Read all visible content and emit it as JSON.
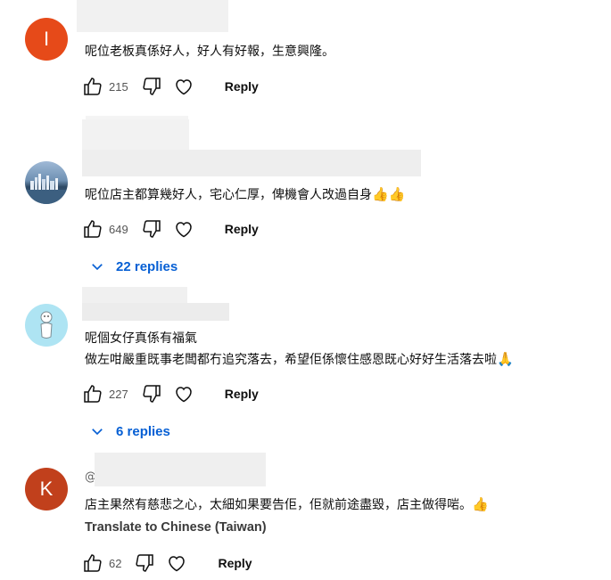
{
  "comments": [
    {
      "avatar_letter": "I",
      "avatar_color": "#e64a19",
      "text": "呢位老板真係好人，好人有好報，生意興隆。",
      "likes": "215",
      "reply_label": "Reply"
    },
    {
      "avatar_letter": "",
      "avatar_color": "#5a7fa3",
      "text": "呢位店主都算幾好人，宅心仁厚，俾機會人改過自身",
      "emoji": "👍👍",
      "likes": "649",
      "reply_label": "Reply",
      "replies_label": "22 replies"
    },
    {
      "avatar_letter": "",
      "avatar_color": "#aee4f3",
      "text_line1": "呢個女仔真係有福氣",
      "text_line2": "做左咁嚴重既事老闆都冇追究落去，希望佢係懷住感恩既心好好生活落去啦",
      "emoji": "🙏",
      "likes": "227",
      "reply_label": "Reply",
      "replies_label": "6 replies"
    },
    {
      "avatar_letter": "K",
      "avatar_color": "#c1401c",
      "handle_prefix": "@",
      "text": "店主果然有慈悲之心，太細如果要告佢，佢就前途盡毀，店主做得啱。",
      "emoji": "👍",
      "translate_label": "Translate to Chinese (Taiwan)",
      "likes": "62",
      "reply_label": "Reply"
    }
  ]
}
